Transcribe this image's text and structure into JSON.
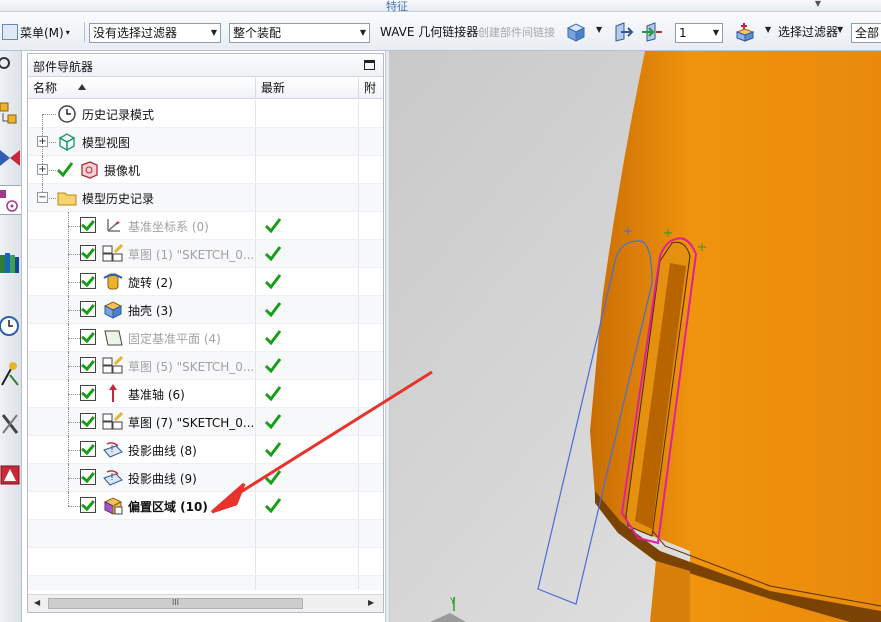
{
  "top_strip": {
    "label": "特征"
  },
  "toolbar": {
    "menu_label": "菜单(M)",
    "menu_caret": "▾",
    "filter_select": "没有选择过滤器",
    "assembly_select": "整个装配",
    "wave_label": "WAVE 几何链接器",
    "create_link_label": "创建部件间链接",
    "count_select": "1",
    "selection_filter_label": "选择过滤器",
    "all_select": "全部"
  },
  "navigator": {
    "title": "部件导航器",
    "columns": [
      "名称",
      "最新",
      "附注"
    ],
    "scroll_glyph": "III",
    "items": [
      {
        "label": "历史记录模式",
        "icon": "clock-icon",
        "style": "normal",
        "check": false,
        "latest": false,
        "expander": ""
      },
      {
        "label": "模型视图",
        "icon": "model-views-icon",
        "style": "normal",
        "check": false,
        "latest": false,
        "expander": "+"
      },
      {
        "label": "摄像机",
        "icon": "camera-icon",
        "style": "normal",
        "check": true,
        "latest": false,
        "expander": "+"
      },
      {
        "label": "模型历史记录",
        "icon": "folder-icon",
        "style": "normal",
        "check": false,
        "latest": false,
        "expander": "−"
      },
      {
        "label": "基准坐标系 (0)",
        "icon": "datum-csys-icon",
        "style": "grey",
        "check": true,
        "latest": true,
        "expander": ""
      },
      {
        "label": "草图 (1) \"SKETCH_0...",
        "icon": "sketch-icon",
        "style": "grey",
        "check": true,
        "latest": true,
        "expander": ""
      },
      {
        "label": "旋转 (2)",
        "icon": "revolve-icon",
        "style": "normal",
        "check": true,
        "latest": true,
        "expander": ""
      },
      {
        "label": "抽壳 (3)",
        "icon": "shell-icon",
        "style": "normal",
        "check": true,
        "latest": true,
        "expander": ""
      },
      {
        "label": "固定基准平面 (4)",
        "icon": "datum-plane-icon",
        "style": "grey",
        "check": true,
        "latest": true,
        "expander": ""
      },
      {
        "label": "草图 (5) \"SKETCH_0...",
        "icon": "sketch-icon",
        "style": "grey",
        "check": true,
        "latest": true,
        "expander": ""
      },
      {
        "label": "基准轴 (6)",
        "icon": "datum-axis-icon",
        "style": "normal",
        "check": true,
        "latest": true,
        "expander": ""
      },
      {
        "label": "草图 (7) \"SKETCH_0...",
        "icon": "sketch-icon",
        "style": "normal",
        "check": true,
        "latest": true,
        "expander": ""
      },
      {
        "label": "投影曲线 (8)",
        "icon": "project-curve-icon",
        "style": "normal",
        "check": true,
        "latest": true,
        "expander": ""
      },
      {
        "label": "投影曲线 (9)",
        "icon": "project-curve-icon",
        "style": "normal",
        "check": true,
        "latest": true,
        "expander": ""
      },
      {
        "label": "偏置区域 (10)",
        "icon": "offset-region-icon",
        "style": "bold",
        "check": true,
        "latest": true,
        "expander": ""
      }
    ]
  },
  "viewport": {
    "axis_label": "Y",
    "model_color": "#e88a0c",
    "background": "#d6d6d6"
  },
  "colors": {
    "check_green": "#1a9e1a",
    "annotation_red": "#e8322c",
    "curve_blue": "#4a6cd9",
    "curve_magenta": "#e0209a"
  }
}
